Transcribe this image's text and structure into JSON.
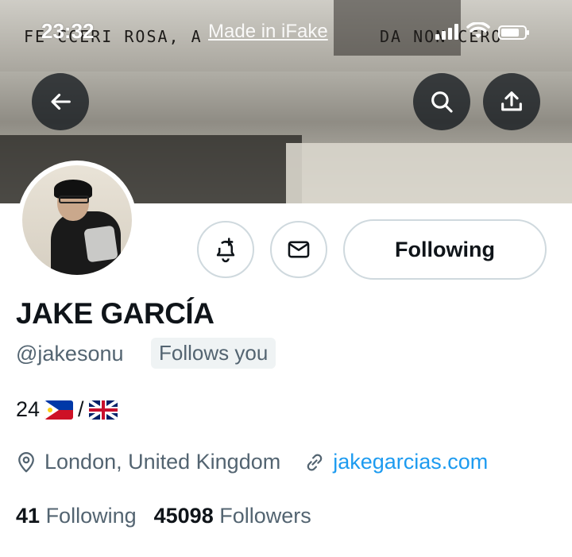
{
  "status_bar": {
    "time": "23:32",
    "watermark": "Made in iFake"
  },
  "banner": {
    "scrawl_left": "FE CCERI ROSA, A",
    "scrawl_right": "DA NON  CERO"
  },
  "icons": {
    "back": "arrow-left-icon",
    "search": "search-icon",
    "share": "share-icon",
    "notify": "bell-plus-icon",
    "message": "envelope-icon",
    "location": "location-pin-icon",
    "link": "link-icon"
  },
  "profile": {
    "display_name": "JAKE GARCÍA",
    "handle": "@jakesonu",
    "follows_you": "Follows you",
    "bio_age": "24",
    "bio_sep": "/",
    "location": "London, United Kingdom",
    "website": "jakegarcias.com"
  },
  "actions": {
    "following_label": "Following"
  },
  "stats": {
    "following_count": "41",
    "following_label": "Following",
    "followers_count": "45098",
    "followers_label": "Followers"
  },
  "colors": {
    "link": "#1d9bf0",
    "secondary_text": "#536471",
    "border": "#cfd9de"
  }
}
